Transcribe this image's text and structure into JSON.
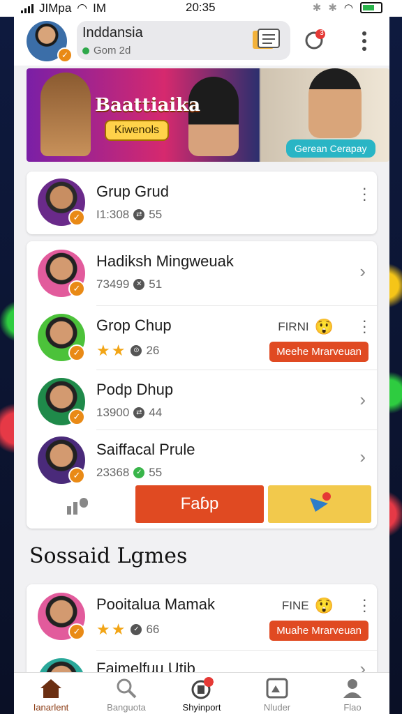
{
  "status": {
    "carrier": "JIMpa",
    "network": "IM",
    "time": "20:35"
  },
  "header": {
    "title": "Inddansia",
    "subtitle": "Gom 2d",
    "notif_count": "3"
  },
  "banner": {
    "title": "Baattiaika",
    "badge": "Kiwenols",
    "chip": "Gerean Cerapay"
  },
  "cards": {
    "single": {
      "name": "Grup Grud",
      "meta_value": "I1:308",
      "meta_count": "55"
    },
    "rows": [
      {
        "name": "Hadiksh Mingweuak",
        "meta_value": "73499",
        "meta_count": "51"
      },
      {
        "name": "Grop Chup",
        "stars": "★★",
        "meta_count": "26",
        "tag": "FIRNI",
        "action": "Meehe Mrarveuan"
      },
      {
        "name": "Podp Dhup",
        "meta_value": "13900",
        "meta_count": "44"
      },
      {
        "name": "Saiffacal Prule",
        "meta_value": "23368",
        "meta_count": "55"
      }
    ],
    "primary_button": "Faɓp"
  },
  "section": {
    "title": "Sossaid Lgmes",
    "rows": [
      {
        "name": "Pooitalua Mamak",
        "stars": "★★",
        "meta_count": "66",
        "tag": "FINE",
        "action": "Muahe Mrarveuan"
      },
      {
        "name": "Faimelfuu Uţib"
      }
    ]
  },
  "nav": [
    {
      "label": "Ianarlent",
      "icon": "home-icon"
    },
    {
      "label": "Banguota",
      "icon": "search-icon"
    },
    {
      "label": "Shyinport",
      "icon": "activity-icon",
      "badge": "1"
    },
    {
      "label": "Nluder",
      "icon": "gallery-icon"
    },
    {
      "label": "Flao",
      "icon": "profile-icon"
    }
  ],
  "colors": {
    "accent": "#e04a22",
    "check": "#e98a16",
    "yellow": "#f2c94c",
    "star": "#f2a516"
  }
}
